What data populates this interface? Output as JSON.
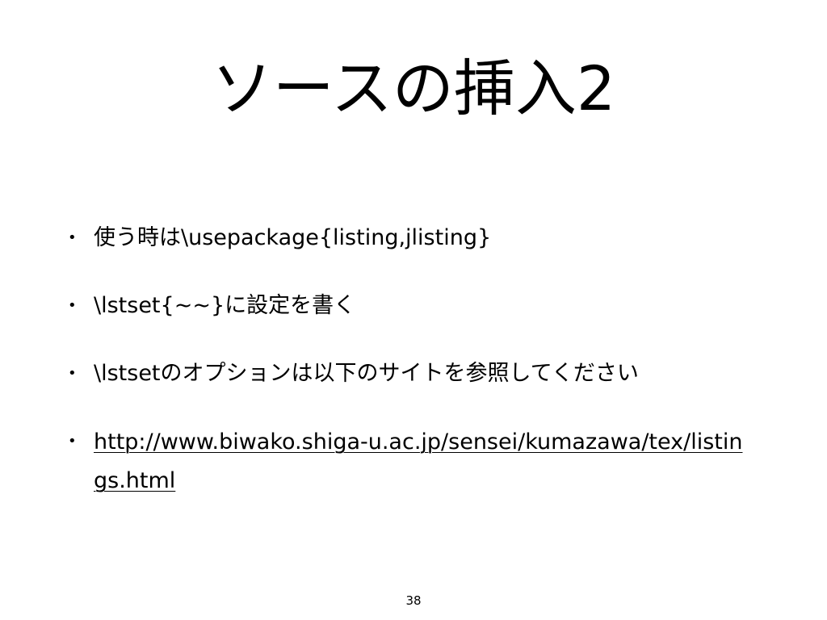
{
  "slide": {
    "title": "ソースの挿入2",
    "bullets": [
      {
        "marker": "•",
        "text": "使う時は\\usepackage{listing,jlisting}"
      },
      {
        "marker": "•",
        "text": "\\lstset{~~}に設定を書く"
      },
      {
        "marker": "•",
        "text": "\\lstsetのオプションは以下のサイトを参照してください"
      },
      {
        "marker": "•",
        "link": "http://www.biwako.shiga-u.ac.jp/sensei/kumazawa/tex/listings.html"
      }
    ],
    "page_number": "38"
  }
}
